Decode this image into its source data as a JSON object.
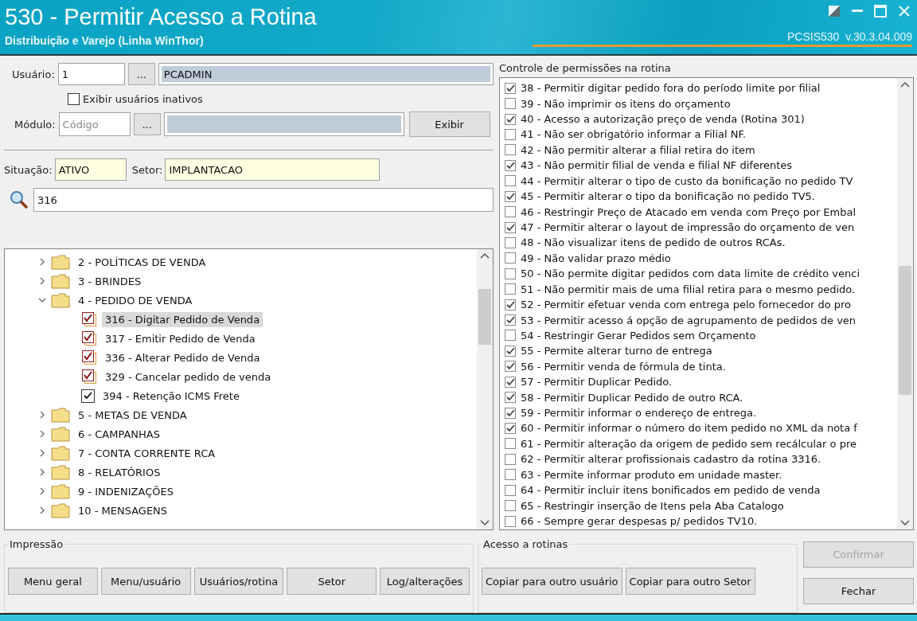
{
  "window": {
    "title": "530 - Permitir Acesso a Rotina",
    "subtitle": "Distribuição e Varejo (Linha WinThor)",
    "version": "PCSIS530  v.30.3.04.009"
  },
  "user": {
    "label": "Usuário:",
    "code": "1",
    "lookup_button": "...",
    "name": "PCADMIN"
  },
  "show_inactive": {
    "label": "Exibir usuários inativos",
    "checked": false
  },
  "module": {
    "label": "Módulo:",
    "placeholder": "Código",
    "lookup_button": "...",
    "button": "Exibir"
  },
  "situation": {
    "label": "Situação:",
    "value": "ATIVO"
  },
  "sector": {
    "label": "Setor:",
    "value": "IMPLANTACAO"
  },
  "search": {
    "value": "316"
  },
  "tree": [
    {
      "label": "2 - POLÍTICAS DE VENDA",
      "expanded": false,
      "selected": false
    },
    {
      "label": "3 - BRINDES",
      "expanded": false,
      "selected": false
    },
    {
      "label": "4 - PEDIDO DE VENDA",
      "expanded": true,
      "selected": false,
      "children": [
        {
          "label": "316 - Digitar Pedido de Venda",
          "checked": true,
          "kind": "stacked",
          "selected": true
        },
        {
          "label": "317 - Emitir Pedido de Venda",
          "checked": true,
          "kind": "stacked",
          "selected": false
        },
        {
          "label": "336 - Alterar Pedido de Venda",
          "checked": true,
          "kind": "stacked",
          "selected": false
        },
        {
          "label": "329 - Cancelar pedido de venda",
          "checked": true,
          "kind": "stacked",
          "selected": false
        },
        {
          "label": "394 - Retenção ICMS Frete",
          "checked": true,
          "kind": "plain",
          "selected": false
        }
      ]
    },
    {
      "label": "5 - METAS DE VENDA",
      "expanded": false,
      "selected": false
    },
    {
      "label": "6 - CAMPANHAS",
      "expanded": false,
      "selected": false
    },
    {
      "label": "7 - CONTA CORRENTE RCA",
      "expanded": false,
      "selected": false
    },
    {
      "label": "8 - RELATÓRIOS",
      "expanded": false,
      "selected": false
    },
    {
      "label": "9 - INDENIZAÇÕES",
      "expanded": false,
      "selected": false
    },
    {
      "label": "10 - MENSAGENS",
      "expanded": false,
      "selected": false
    }
  ],
  "permissions": {
    "title": "Controle de permissões na rotina",
    "items": [
      {
        "label": "38 - Permitir digitar pedido fora do período limite por filial",
        "checked": true
      },
      {
        "label": "39 - Não imprimir os itens do orçamento",
        "checked": false
      },
      {
        "label": "40 - Acesso a autorização preço de venda (Rotina 301)",
        "checked": true
      },
      {
        "label": "41 - Não ser obrigatório informar a Filial NF.",
        "checked": false
      },
      {
        "label": "42 - Não permitir alterar a filial retira do item",
        "checked": false
      },
      {
        "label": "43 - Não permitir filial de venda e filial NF diferentes",
        "checked": true
      },
      {
        "label": "44 - Permitir alterar o tipo de custo da bonificação no pedido TV",
        "checked": false
      },
      {
        "label": "45 - Permitir alterar o tipo da bonificação no pedido TV5.",
        "checked": true
      },
      {
        "label": "46 - Restringir Preço de Atacado em venda com Preço por Embal",
        "checked": false
      },
      {
        "label": "47 - Permitir alterar o layout de impressão do orçamento de ven",
        "checked": true
      },
      {
        "label": "48 - Não visualizar itens de pedido de outros RCAs.",
        "checked": false
      },
      {
        "label": "49 - Não validar prazo médio",
        "checked": false
      },
      {
        "label": "50 - Não permite digitar pedidos com data limite de crédito venci",
        "checked": false
      },
      {
        "label": "51 - Não permitir mais de uma filial retira para o mesmo pedido.",
        "checked": false
      },
      {
        "label": "52 - Permitir efetuar venda com entrega pelo fornecedor do pro",
        "checked": true
      },
      {
        "label": "53 - Permitir acesso á opção de agrupamento de pedidos de ven",
        "checked": true
      },
      {
        "label": "54 - Restringir Gerar Pedidos sem Orçamento",
        "checked": false
      },
      {
        "label": "55 - Permite alterar turno de entrega",
        "checked": true
      },
      {
        "label": "56 - Permitir venda de fórmula de tinta.",
        "checked": true
      },
      {
        "label": "57 - Permitir Duplicar Pedido.",
        "checked": true
      },
      {
        "label": "58 - Permitir Duplicar Pedido de outro RCA.",
        "checked": true
      },
      {
        "label": "59 - Permitir informar o endereço de entrega.",
        "checked": true
      },
      {
        "label": "60 - Permitir informar o número do item pedido no XML da nota f",
        "checked": true
      },
      {
        "label": "61 - Permitir alteração da origem de pedido sem recálcular o pre",
        "checked": false
      },
      {
        "label": "62 - Permitir alterar profissionais cadastro da rotina 3316.",
        "checked": false
      },
      {
        "label": "63 - Permite informar produto em unidade master.",
        "checked": false
      },
      {
        "label": "64 - Permitir incluir itens bonificados em pedido de venda",
        "checked": false
      },
      {
        "label": "65 - Restringir inserção de Itens pela Aba Catalogo",
        "checked": false
      },
      {
        "label": "66 - Sempre gerar despesas p/ pedidos TV10.",
        "checked": false
      }
    ]
  },
  "print_group": {
    "title": "Impressão",
    "buttons": [
      "Menu geral",
      "Menu/usuário",
      "Usuários/rotina",
      "Setor",
      "Log/alterações"
    ]
  },
  "access_group": {
    "title": "Acesso a rotinas",
    "buttons": [
      "Copiar para outro usuário",
      "Copiar para outro Setor"
    ]
  },
  "actions": [
    {
      "label": "Confirmar",
      "disabled": true
    },
    {
      "label": "Fechar",
      "disabled": false
    }
  ]
}
